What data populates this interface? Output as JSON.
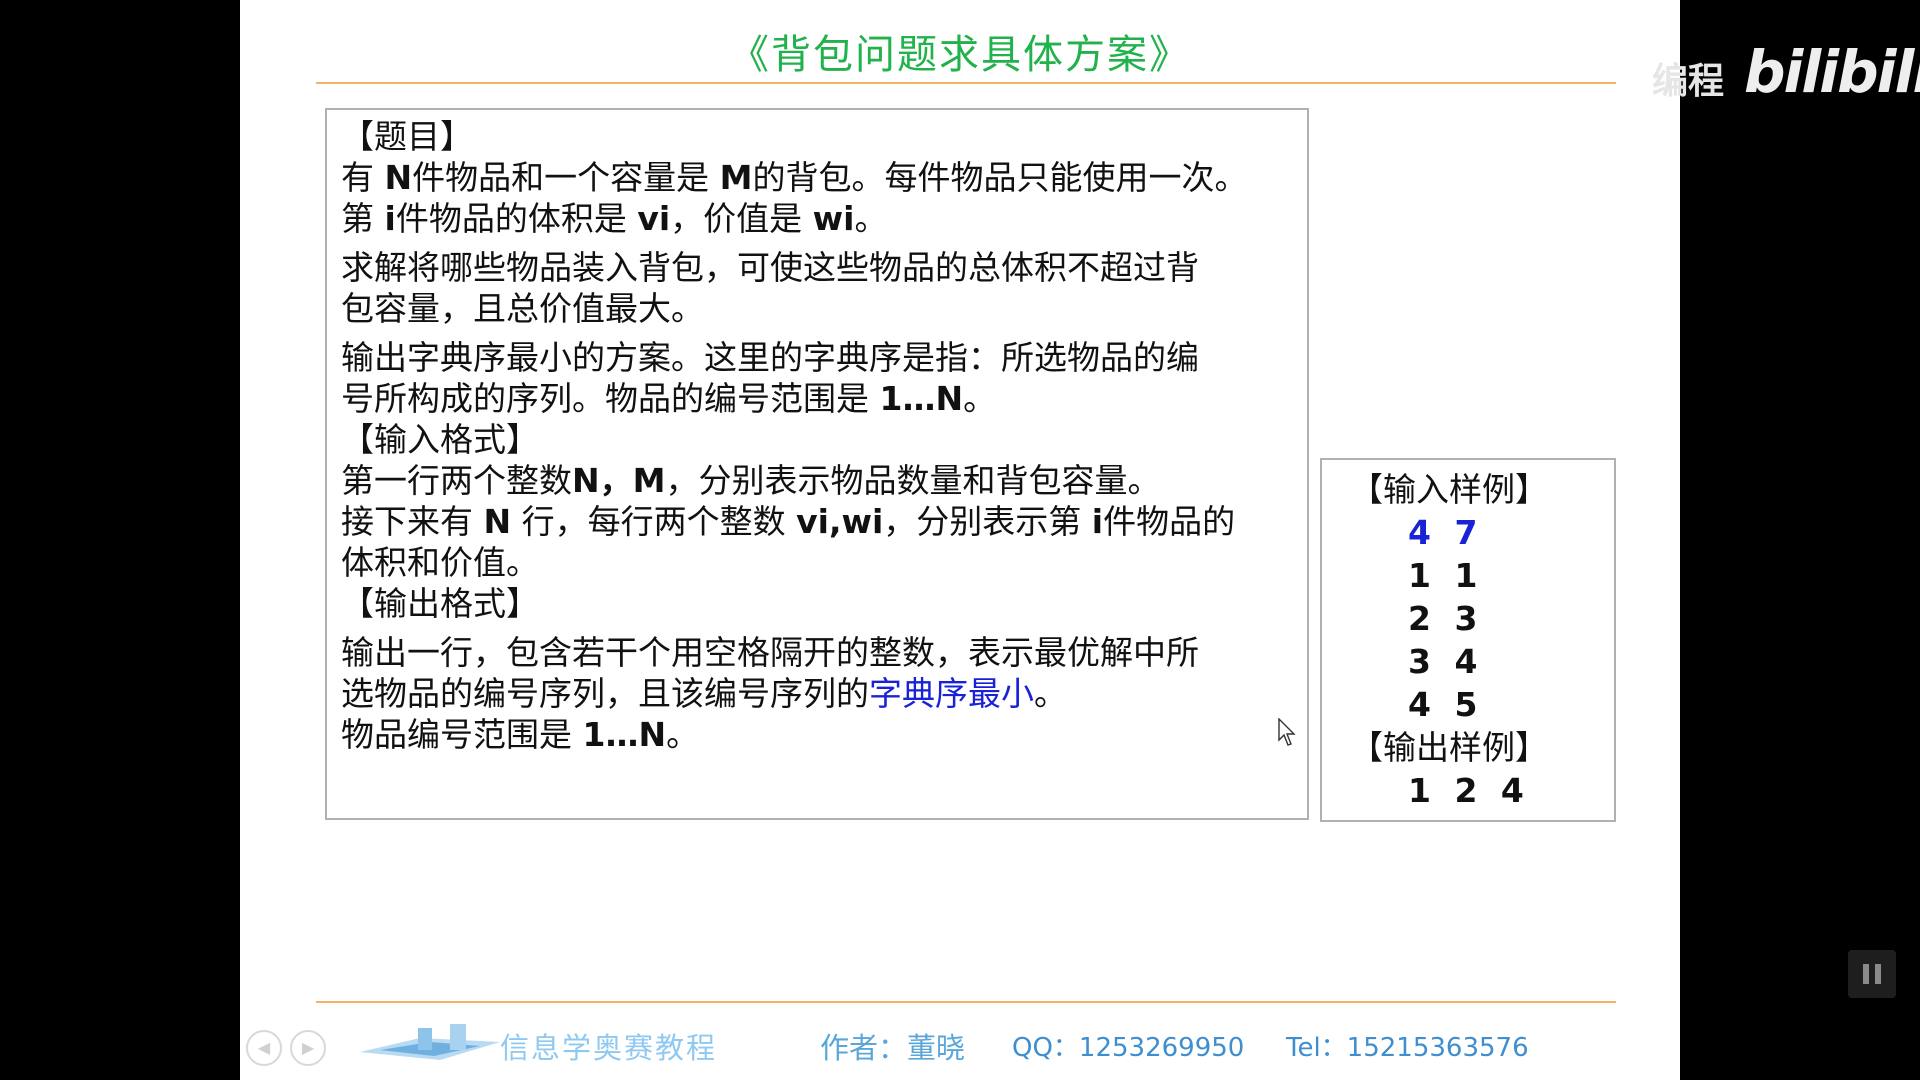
{
  "slide": {
    "title": "《背包问题求具体方案》",
    "problem": {
      "heading": "【题目】",
      "line1_a": "有",
      "line1_n": "N",
      "line1_b": "件物品和一个容量是",
      "line1_m": "M",
      "line1_c": "的背包。每件物品只能使用一次。",
      "line2_a": "第",
      "line2_i": "i",
      "line2_b": "件物品的体积是",
      "line2_vi": "vi",
      "line2_c": "，价值是",
      "line2_wi": "wi",
      "line2_d": "。",
      "para2_l1": "求解将哪些物品装入背包，可使这些物品的总体积不超过背",
      "para2_l2": "包容量，且总价值最大。",
      "para3_l1": "输出字典序最小的方案。这里的字典序是指：所选物品的编",
      "para3_l2a": "号所构成的序列。物品的编号范围是",
      "para3_l2b": "1…N",
      "para3_l2c": "。"
    },
    "input_format": {
      "heading": "【输入格式】",
      "line1_a": "第一行两个整数",
      "line1_b": "N，M",
      "line1_c": "，分别表示物品数量和背包容量。",
      "line2_a": "接下来有",
      "line2_b": "N",
      "line2_c": "行，每行两个整数",
      "line2_d": "vi,wi",
      "line2_e": "，分别表示第",
      "line2_f": "i",
      "line2_g": "件物品的",
      "line3": "体积和价值。"
    },
    "output_format": {
      "heading": "【输出格式】",
      "line1": "输出一行，包含若干个用空格隔开的整数，表示最优解中所",
      "line2_a": "选物品的编号序列，且该编号序列的",
      "line2_highlight": "字典序最小",
      "line2_b": "。",
      "line3_a": "物品编号范围是",
      "line3_b": "1…N",
      "line3_c": "。"
    },
    "sample": {
      "input_heading": "【输入样例】",
      "input_rows": [
        "4 7",
        "1 1",
        "2 3",
        "3 4",
        "4 5"
      ],
      "output_heading": "【输出样例】",
      "output_row": "1 2 4"
    },
    "footer": {
      "logo_text": "信息学奥赛教程",
      "author": "作者：董晓",
      "qq": "QQ：1253269950",
      "tel": "Tel：15215363576"
    }
  },
  "overlay": {
    "watermark_text": "编程",
    "watermark_logo": "bilibili"
  },
  "colors": {
    "title_green": "#22b24c",
    "rule_orange": "#f3b36a",
    "highlight_blue": "#1a22d6"
  }
}
